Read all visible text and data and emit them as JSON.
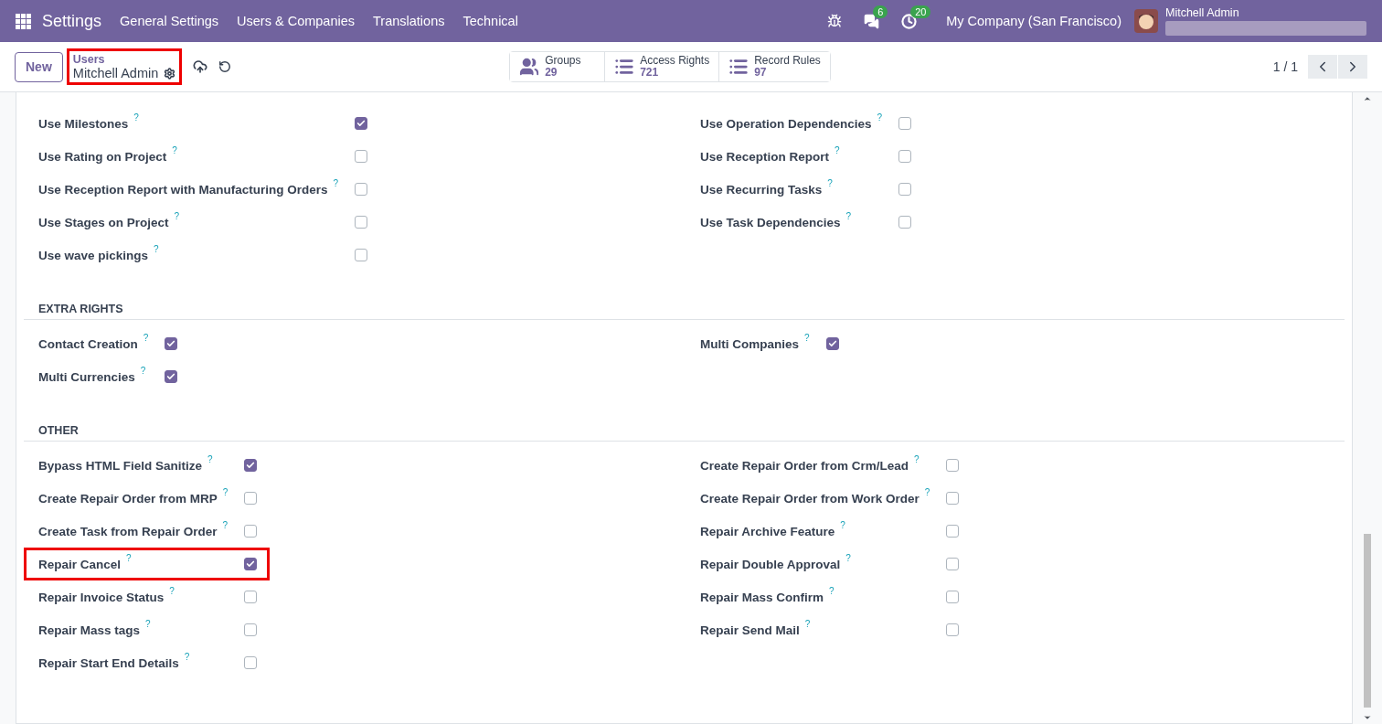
{
  "navbar": {
    "app": "Settings",
    "menu": [
      "General Settings",
      "Users & Companies",
      "Translations",
      "Technical"
    ],
    "messages_count": "6",
    "activities_count": "20",
    "company": "My Company (San Francisco)",
    "user": "Mitchell Admin"
  },
  "control_panel": {
    "new_button": "New",
    "breadcrumb": {
      "parent": "Users",
      "current": "Mitchell Admin",
      "highlighted": true
    },
    "smart_buttons": [
      {
        "kind": "groups",
        "label": "Groups",
        "count": "29"
      },
      {
        "kind": "list",
        "label": "Access Rights",
        "count": "721"
      },
      {
        "kind": "rules",
        "label": "Record Rules",
        "count": "97"
      }
    ],
    "pager": "1 / 1"
  },
  "sections": [
    {
      "left": [
        {
          "label": "Use Milestones",
          "help": "?",
          "checked": true,
          "highlighted": false
        },
        {
          "label": "Use Rating on Project",
          "help": "?",
          "checked": false,
          "highlighted": false
        },
        {
          "label": "Use Reception Report with Manufacturing Orders",
          "help": "?",
          "checked": false,
          "highlighted": false
        },
        {
          "label": "Use Stages on Project",
          "help": "?",
          "checked": false,
          "highlighted": false
        },
        {
          "label": "Use wave pickings",
          "help": "?",
          "checked": false,
          "highlighted": false
        }
      ],
      "right": [
        {
          "label": "Use Operation Dependencies",
          "help": "?",
          "checked": false,
          "highlighted": false
        },
        {
          "label": "Use Reception Report",
          "help": "?",
          "checked": false,
          "highlighted": false
        },
        {
          "label": "Use Recurring Tasks",
          "help": "?",
          "checked": false,
          "highlighted": false
        },
        {
          "label": "Use Task Dependencies",
          "help": "?",
          "checked": false,
          "highlighted": false
        }
      ]
    },
    {
      "title": "EXTRA RIGHTS",
      "left": [
        {
          "label": "Contact Creation",
          "help": "?",
          "checked": true,
          "highlighted": false
        },
        {
          "label": "Multi Currencies",
          "help": "?",
          "checked": true,
          "highlighted": false
        }
      ],
      "right": [
        {
          "label": "Multi Companies",
          "help": "?",
          "checked": true,
          "highlighted": false
        }
      ]
    },
    {
      "title": "OTHER",
      "left": [
        {
          "label": "Bypass HTML Field Sanitize",
          "help": "?",
          "checked": true,
          "highlighted": false
        },
        {
          "label": "Create Repair Order from MRP",
          "help": "?",
          "checked": false,
          "highlighted": false
        },
        {
          "label": "Create Task from Repair Order",
          "help": "?",
          "checked": false,
          "highlighted": false
        },
        {
          "label": "Repair Cancel",
          "help": "?",
          "checked": true,
          "highlighted": true
        },
        {
          "label": "Repair Invoice Status",
          "help": "?",
          "checked": false,
          "highlighted": false
        },
        {
          "label": "Repair Mass tags",
          "help": "?",
          "checked": false,
          "highlighted": false
        },
        {
          "label": "Repair Start End Details",
          "help": "?",
          "checked": false,
          "highlighted": false
        }
      ],
      "right": [
        {
          "label": "Create Repair Order from Crm/Lead",
          "help": "?",
          "checked": false,
          "highlighted": false
        },
        {
          "label": "Create Repair Order from Work Order",
          "help": "?",
          "checked": false,
          "highlighted": false
        },
        {
          "label": "Repair Archive Feature",
          "help": "?",
          "checked": false,
          "highlighted": false
        },
        {
          "label": "Repair Double Approval",
          "help": "?",
          "checked": false,
          "highlighted": false
        },
        {
          "label": "Repair Mass Confirm",
          "help": "?",
          "checked": false,
          "highlighted": false
        },
        {
          "label": "Repair Send Mail",
          "help": "?",
          "checked": false,
          "highlighted": false
        }
      ]
    }
  ]
}
